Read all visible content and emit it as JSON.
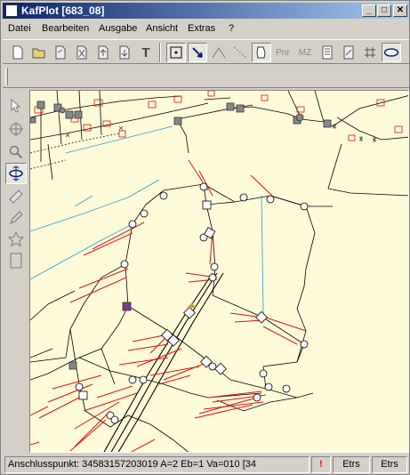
{
  "window": {
    "title": "KafPlot [683_08]",
    "buttons": {
      "minimize": "_",
      "maximize": "□",
      "close": "✕"
    }
  },
  "menu": {
    "items": [
      {
        "label": "Datei"
      },
      {
        "label": "Bearbeiten"
      },
      {
        "label": "Ausgabe"
      },
      {
        "label": "Ansicht"
      },
      {
        "label": "Extras"
      },
      {
        "label": "?"
      }
    ]
  },
  "toolbar": {
    "text_tool": "T",
    "pnr": "Pnr",
    "mz": "MZ"
  },
  "status": {
    "text": "Anschlusspunkt: 34583157203019  A=2  Eb=1  Va=010  [34",
    "warning": "!",
    "etrs1": "Etrs",
    "etrs2": "Etrs"
  },
  "colors": {
    "title_start": "#0a246a",
    "title_end": "#a6caf0",
    "canvas_bg": "#fffbd8",
    "red_lines": "#e01010",
    "blue_lines": "#2a9ad8",
    "point_marker_fill": "#888888",
    "selected_point": "#7a3a8a"
  }
}
